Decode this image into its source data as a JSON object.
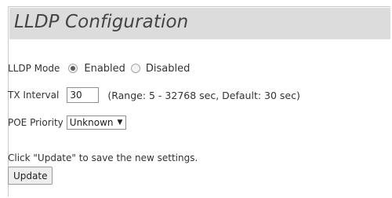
{
  "header": {
    "title": "LLDP Configuration"
  },
  "form": {
    "lldp_mode": {
      "label": "LLDP Mode",
      "options": [
        "Enabled",
        "Disabled"
      ],
      "selected": "Enabled"
    },
    "tx_interval": {
      "label": "TX Interval",
      "value": "30",
      "hint": "(Range: 5 - 32768 sec, Default: 30 sec)"
    },
    "poe_priority": {
      "label": "POE Priority",
      "selected": "Unknown"
    }
  },
  "footer": {
    "instruction": "Click \"Update\" to save the new settings.",
    "update_label": "Update"
  },
  "colors": {
    "title_bar_bg": "#dcdcdc",
    "panel_border": "#c8c8c8"
  }
}
